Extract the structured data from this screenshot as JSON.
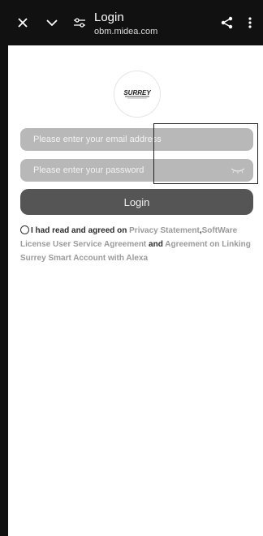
{
  "browser": {
    "title": "Login",
    "url": "obm.midea.com"
  },
  "logo": {
    "text": "SURREY"
  },
  "form": {
    "email_placeholder": "Please enter your email address",
    "password_placeholder": "Please enter your password",
    "login_label": "Login"
  },
  "agreement": {
    "prefix": "I had read and agreed on",
    "privacy": "Privacy Statement",
    "comma": ",",
    "license": "SoftWare License User Service Agreement",
    "and": "and",
    "alexa": "Agreement on Linking Surrey Smart Account with Alexa"
  },
  "colors": {
    "topbar": "#111111",
    "input_bg": "#b8b8b8",
    "button_bg": "#555555",
    "link_text": "#9a9a9a"
  },
  "icons": [
    "close-icon",
    "chevron-down-icon",
    "tune-icon",
    "share-icon",
    "more-vert-icon",
    "eye-closed-icon"
  ]
}
